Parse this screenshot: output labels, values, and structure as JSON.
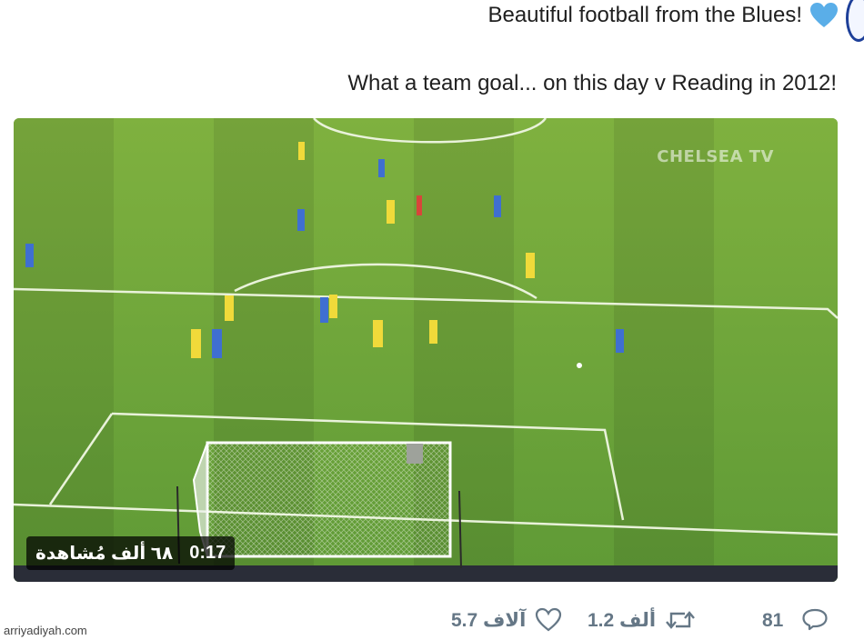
{
  "tweet": {
    "line1": "Beautiful football from the Blues!",
    "line2": "What a team goal... on this day v Reading in 2012!"
  },
  "video": {
    "watermark": "CHELSEA TV",
    "duration": "0:17",
    "views": "٦٨ ألف مُشاهدة"
  },
  "actions": {
    "likes": "5.7 آلاف",
    "retweets": "1.2 ألف",
    "replies": "81"
  },
  "source": "arriyadiyah.com",
  "colors": {
    "heart": "#5aaee8",
    "pitch": "#6da13a",
    "action_gray": "#657786"
  },
  "icons": [
    "heart-icon",
    "like-icon",
    "retweet-icon",
    "reply-icon"
  ]
}
